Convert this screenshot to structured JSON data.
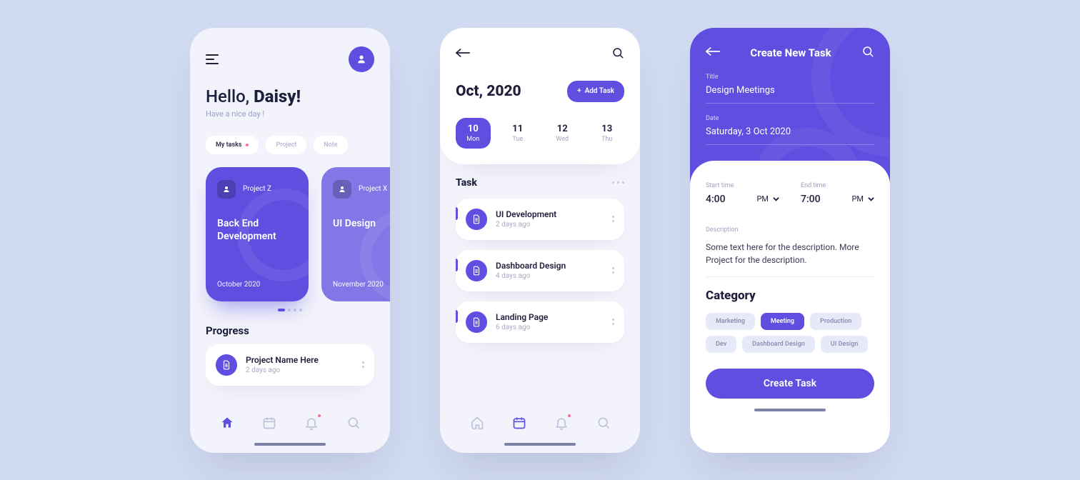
{
  "colors": {
    "primary": "#5f4ee0",
    "accent_pink": "#ff6b9a",
    "page_bg": "#d0daf1"
  },
  "screen1": {
    "greeting_prefix": "Hello, ",
    "greeting_name": "Daisy!",
    "subtitle": "Have a nice day !",
    "tabs": [
      {
        "label": "My tasks",
        "active": true,
        "dot": true
      },
      {
        "label": "Project",
        "active": false
      },
      {
        "label": "Note",
        "active": false
      }
    ],
    "projects": [
      {
        "name": "Project Z",
        "title_l1": "Back End",
        "title_l2": "Development",
        "date": "October 2020"
      },
      {
        "name": "Project X",
        "title_l1": "UI Design",
        "title_l2": "",
        "date": "November 2020"
      }
    ],
    "progress_header": "Progress",
    "progress_item": {
      "title": "Project Name Here",
      "sub": "2 days ago"
    },
    "nav_icons": [
      "home-icon",
      "calendar-icon",
      "bell-icon",
      "search-icon"
    ]
  },
  "screen2": {
    "month": "Oct, 2020",
    "add_task_label": "Add Task",
    "days": [
      {
        "num": "10",
        "dow": "Mon",
        "selected": true
      },
      {
        "num": "11",
        "dow": "Tue"
      },
      {
        "num": "12",
        "dow": "Wed"
      },
      {
        "num": "13",
        "dow": "Thu"
      }
    ],
    "task_header": "Task",
    "tasks": [
      {
        "title": "UI Development",
        "sub": "2 days ago"
      },
      {
        "title": "Dashboard Design",
        "sub": "4 days ago"
      },
      {
        "title": "Landing Page",
        "sub": "6 days ago"
      }
    ],
    "nav_icons": [
      "home-icon",
      "calendar-icon",
      "bell-icon",
      "search-icon"
    ]
  },
  "screen3": {
    "header_title": "Create New Task",
    "title_label": "Title",
    "title_value": "Design Meetings",
    "date_label": "Date",
    "date_value": "Saturday, 3 Oct 2020",
    "start_label": "Start time",
    "start_value": "4:00",
    "start_ampm": "PM",
    "end_label": "End time",
    "end_value": "7:00",
    "end_ampm": "PM",
    "desc_label": "Description",
    "desc_value": "Some text here for the description. More Project for the description.",
    "category_header": "Category",
    "chips": [
      {
        "label": "Marketing"
      },
      {
        "label": "Meeting",
        "selected": true
      },
      {
        "label": "Production"
      },
      {
        "label": "Dev"
      },
      {
        "label": "Dashboard Design"
      },
      {
        "label": "UI Design"
      }
    ],
    "create_button": "Create Task"
  }
}
